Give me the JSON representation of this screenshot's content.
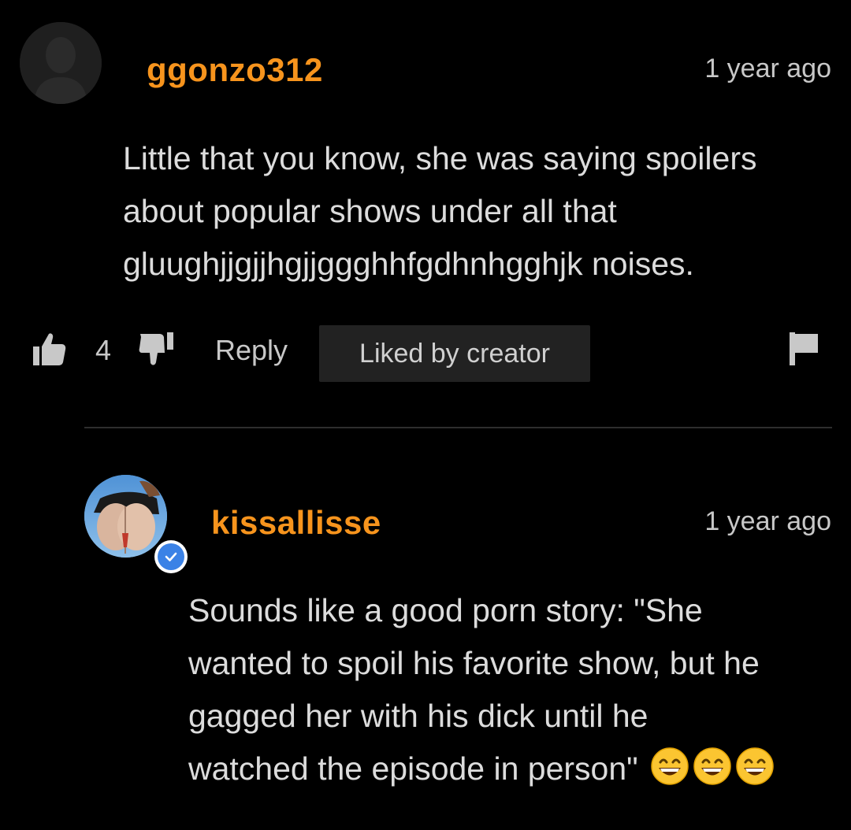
{
  "comments": [
    {
      "username": "ggonzo312",
      "timestamp": "1 year ago",
      "body_lines": [
        "Little that you know, she was saying spoilers",
        "about popular shows under all that",
        "gluughjjgjjhgjjggghhfgdhnhgghjk noises."
      ],
      "like_count": "4",
      "reply_label": "Reply",
      "liked_by_creator_label": "Liked by creator",
      "avatar_icon": "default-user-silhouette-icon"
    },
    {
      "username": "kissallisse",
      "timestamp": "1 year ago",
      "verified": true,
      "body_lines": [
        "Sounds like a good porn story: \"She",
        "wanted to spoil his favorite show, but he",
        "gagged her with his dick until he",
        "watched the episode in person\""
      ],
      "emojis": [
        "grinning-face-with-smiling-eyes",
        "grinning-face-with-smiling-eyes",
        "grinning-face-with-smiling-eyes"
      ]
    }
  ],
  "colors": {
    "background": "#000000",
    "username": "#f7941d",
    "text": "#dcdcdc",
    "timestamp": "#c8c8c8",
    "liked_box_bg": "#222222",
    "divider": "#2e2e2e",
    "verified_badge": "#3b82e6"
  }
}
